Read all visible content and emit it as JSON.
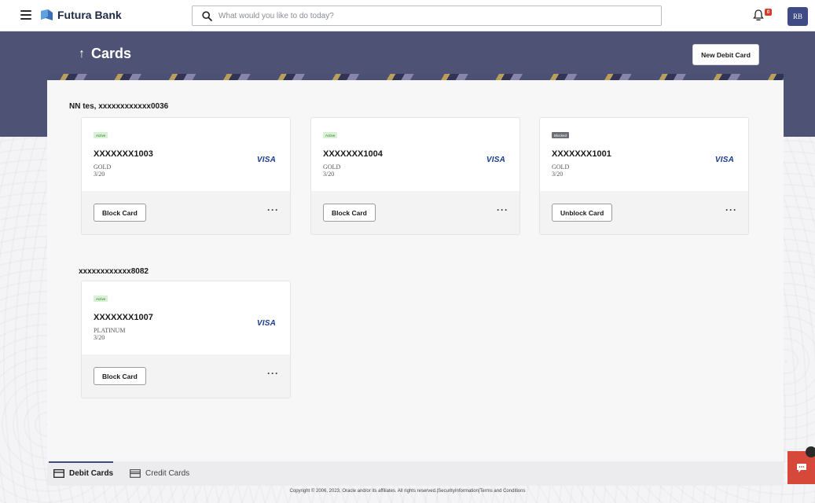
{
  "header": {
    "brand": "Futura Bank",
    "search_placeholder": "What would you like to do today?",
    "notification_count": "0",
    "avatar_initials": "RB"
  },
  "page": {
    "title": "Cards",
    "new_debit_label": "New Debit Card"
  },
  "groups": [
    {
      "title": "NN tes, xxxxxxxxxxxx0036",
      "cards": [
        {
          "status": "Active",
          "number": "XXXXXXX1003",
          "type": "GOLD",
          "expiry": "3/20",
          "network": "VISA",
          "action": "Block Card",
          "more": "···"
        },
        {
          "status": "Active",
          "number": "XXXXXXX1004",
          "type": "GOLD",
          "expiry": "3/20",
          "network": "VISA",
          "action": "Block Card",
          "more": "···"
        },
        {
          "status": "Blocked",
          "number": "XXXXXXX1001",
          "type": "GOLD",
          "expiry": "3/20",
          "network": "VISA",
          "action": "Unblock Card",
          "more": "···"
        }
      ]
    },
    {
      "title": "xxxxxxxxxxxx8082",
      "cards": [
        {
          "status": "Active",
          "number": "XXXXXXX1007",
          "type": "PLATINUM",
          "expiry": "3/20",
          "network": "VISA",
          "action": "Block Card",
          "more": "···"
        }
      ]
    }
  ],
  "tabs": [
    {
      "label": "Debit Cards",
      "active": true
    },
    {
      "label": "Credit Cards",
      "active": false
    }
  ],
  "footer": {
    "copyright": "Copyright © 2006, 2023, Oracle and/or its affiliates. All rights reserved.|SecurityInformation|Terms and Conditions"
  },
  "colors": {
    "band": "#4e5275",
    "primary": "#3f4b86",
    "active_badge": "#d9f1d5",
    "blocked_badge": "#6d6f76",
    "chat": "#d5483a"
  }
}
